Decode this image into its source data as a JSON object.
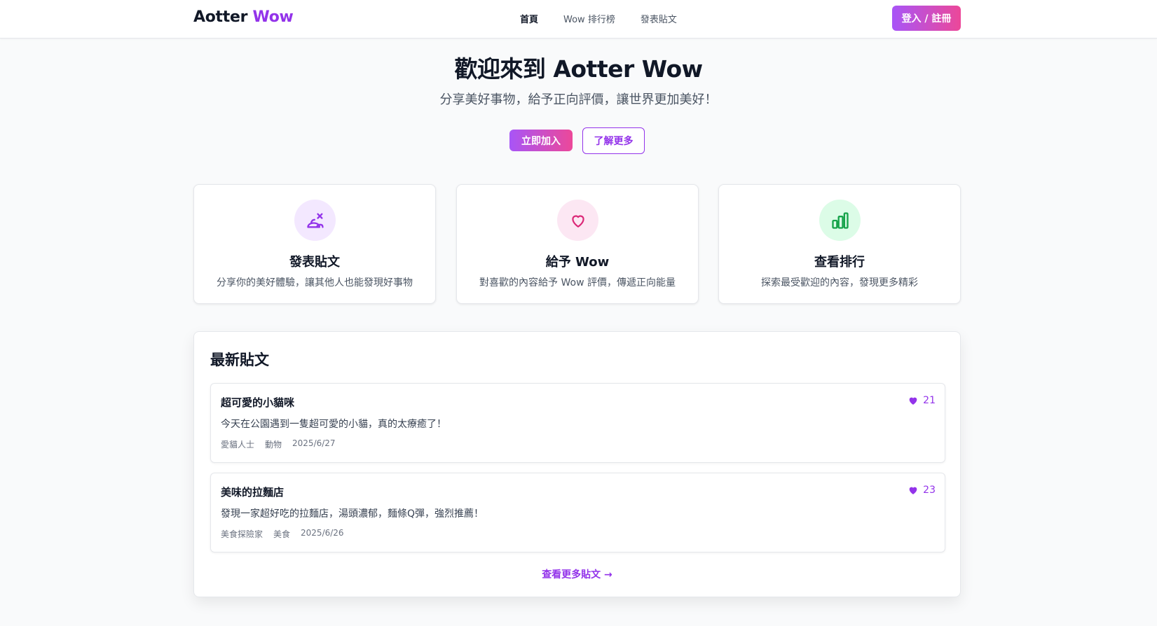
{
  "header": {
    "logo_main": "Aotter",
    "logo_accent": "Wow",
    "nav": [
      {
        "label": "首頁",
        "active": true
      },
      {
        "label": "Wow 排行榜",
        "active": false
      },
      {
        "label": "發表貼文",
        "active": false
      }
    ],
    "login_label": "登入 / 註冊"
  },
  "hero": {
    "title": "歡迎來到 Aotter Wow",
    "subtitle": "分享美好事物，給予正向評價，讓世界更加美好！",
    "join_label": "立即加入",
    "more_label": "了解更多"
  },
  "features": [
    {
      "icon": "post-icon",
      "title": "發表貼文",
      "desc": "分享你的美好體驗，讓其他人也能發現好事物",
      "bg": "#f3e8ff",
      "color": "#9333ea"
    },
    {
      "icon": "heart-icon",
      "title": "給予 Wow",
      "desc": "對喜歡的內容給予 Wow 評價，傳遞正向能量",
      "bg": "#fce7f3",
      "color": "#db2777"
    },
    {
      "icon": "ranking-icon",
      "title": "查看排行",
      "desc": "探索最受歡迎的內容，發現更多精彩",
      "bg": "#dcfce7",
      "color": "#16a34a"
    }
  ],
  "latest": {
    "title": "最新貼文",
    "posts": [
      {
        "title": "超可愛的小貓咪",
        "content": "今天在公園遇到一隻超可愛的小貓，真的太療癒了！",
        "author": "愛貓人士",
        "category": "動物",
        "date": "2025/6/27",
        "likes": "21"
      },
      {
        "title": "美味的拉麵店",
        "content": "發現一家超好吃的拉麵店，湯頭濃郁，麵條Q彈，強烈推薦！",
        "author": "美食探險家",
        "category": "美食",
        "date": "2025/6/26",
        "likes": "23"
      }
    ],
    "see_more_label": "查看更多貼文 →"
  },
  "colors": {
    "accent": "#9333ea",
    "pink": "#ec4899"
  }
}
